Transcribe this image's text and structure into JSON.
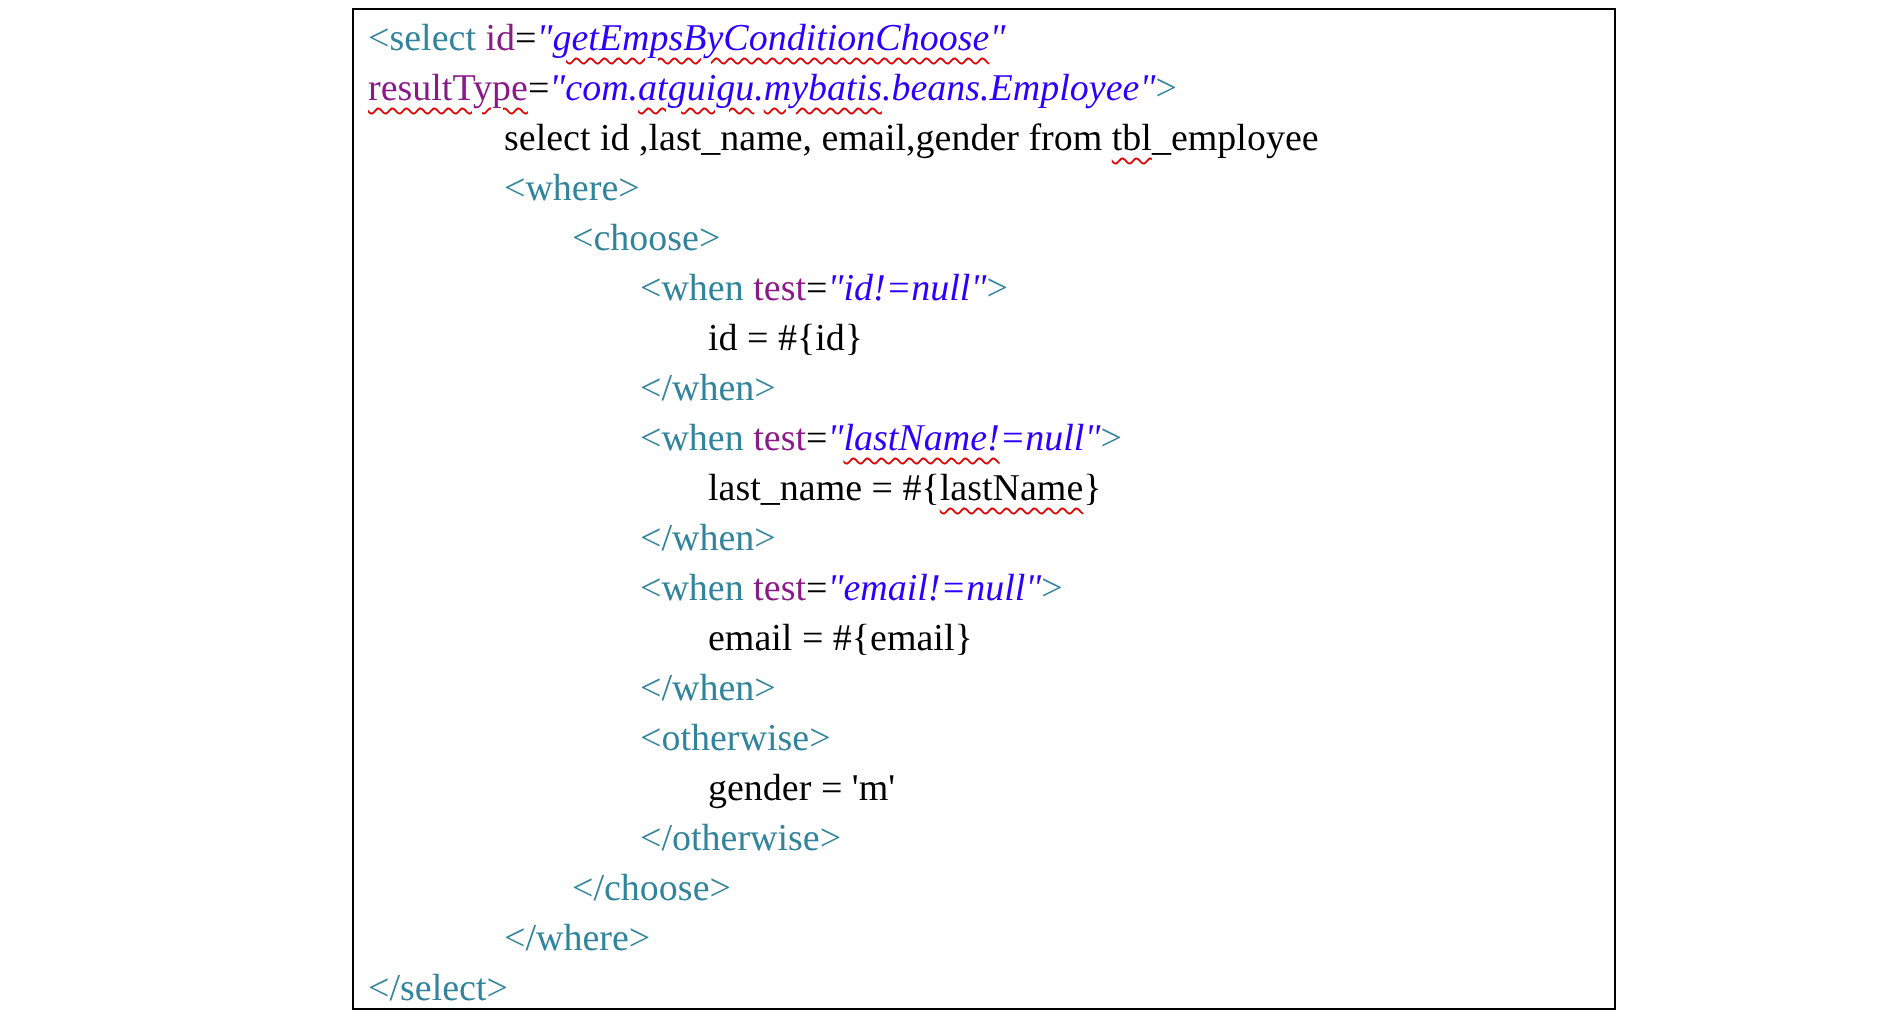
{
  "code_box": {
    "lines": [
      {
        "tokens": [
          {
            "kind": "tag",
            "text": "<select "
          },
          {
            "kind": "attr",
            "text": "id"
          },
          {
            "kind": "text",
            "text": "="
          },
          {
            "kind": "value",
            "text": "\""
          },
          {
            "kind": "value",
            "text": "getEmpsByConditionChoose",
            "underlined": true
          },
          {
            "kind": "value",
            "text": "\""
          }
        ]
      },
      {
        "tokens": [
          {
            "kind": "attr",
            "text": "resultType",
            "underlined": true
          },
          {
            "kind": "text",
            "text": "="
          },
          {
            "kind": "value",
            "text": "\"com."
          },
          {
            "kind": "value",
            "text": "atguigu",
            "underlined": true
          },
          {
            "kind": "value",
            "text": "."
          },
          {
            "kind": "value",
            "text": "mybatis",
            "underlined": true
          },
          {
            "kind": "value",
            "text": ".beans.Employee\""
          },
          {
            "kind": "tag",
            "text": ">"
          }
        ],
        "children": [
          {
            "tokens": [
              {
                "kind": "text",
                "text": "select id ,last_name, email,gender from "
              },
              {
                "kind": "text",
                "text": "tbl",
                "underlined": true
              },
              {
                "kind": "text",
                "text": "_employee"
              }
            ]
          },
          {
            "tokens": [
              {
                "kind": "tag",
                "text": "<where>"
              }
            ],
            "children": [
              {
                "tokens": [
                  {
                    "kind": "tag",
                    "text": "<choose>"
                  }
                ],
                "children": [
                  {
                    "tokens": [
                      {
                        "kind": "tag",
                        "text": "<when "
                      },
                      {
                        "kind": "attr",
                        "text": "test"
                      },
                      {
                        "kind": "text",
                        "text": "="
                      },
                      {
                        "kind": "value",
                        "text": "\"id!=null\""
                      },
                      {
                        "kind": "tag",
                        "text": ">"
                      }
                    ],
                    "children": [
                      {
                        "tokens": [
                          {
                            "kind": "text",
                            "text": "id = #{id}"
                          }
                        ]
                      }
                    ]
                  },
                  {
                    "tokens": [
                      {
                        "kind": "tag",
                        "text": "</when>"
                      }
                    ]
                  },
                  {
                    "tokens": [
                      {
                        "kind": "tag",
                        "text": "<when "
                      },
                      {
                        "kind": "attr",
                        "text": "test"
                      },
                      {
                        "kind": "text",
                        "text": "="
                      },
                      {
                        "kind": "value",
                        "text": "\""
                      },
                      {
                        "kind": "value",
                        "text": "lastName!",
                        "underlined": true
                      },
                      {
                        "kind": "value",
                        "text": "=null\""
                      },
                      {
                        "kind": "tag",
                        "text": ">"
                      }
                    ],
                    "children": [
                      {
                        "tokens": [
                          {
                            "kind": "text",
                            "text": "last_name = #{"
                          },
                          {
                            "kind": "text",
                            "text": "lastName",
                            "underlined": true
                          },
                          {
                            "kind": "text",
                            "text": "}"
                          }
                        ]
                      }
                    ]
                  },
                  {
                    "tokens": [
                      {
                        "kind": "tag",
                        "text": "</when>"
                      }
                    ]
                  },
                  {
                    "tokens": [
                      {
                        "kind": "tag",
                        "text": "<when "
                      },
                      {
                        "kind": "attr",
                        "text": "test"
                      },
                      {
                        "kind": "text",
                        "text": "="
                      },
                      {
                        "kind": "value",
                        "text": "\"email!=null\""
                      },
                      {
                        "kind": "tag",
                        "text": ">"
                      }
                    ],
                    "children": [
                      {
                        "tokens": [
                          {
                            "kind": "text",
                            "text": "email = #{email}"
                          }
                        ]
                      }
                    ]
                  },
                  {
                    "tokens": [
                      {
                        "kind": "tag",
                        "text": "</when>"
                      }
                    ]
                  },
                  {
                    "tokens": [
                      {
                        "kind": "tag",
                        "text": "<otherwise>"
                      }
                    ],
                    "children": [
                      {
                        "tokens": [
                          {
                            "kind": "text",
                            "text": "gender = 'm'"
                          }
                        ]
                      }
                    ]
                  },
                  {
                    "tokens": [
                      {
                        "kind": "tag",
                        "text": "</otherwise>"
                      }
                    ]
                  }
                ]
              },
              {
                "tokens": [
                  {
                    "kind": "tag",
                    "text": "</choose>"
                  }
                ]
              }
            ]
          },
          {
            "tokens": [
              {
                "kind": "tag",
                "text": "</where>"
              }
            ]
          }
        ]
      },
      {
        "tokens": [
          {
            "kind": "tag",
            "text": "</select>"
          }
        ]
      }
    ]
  }
}
